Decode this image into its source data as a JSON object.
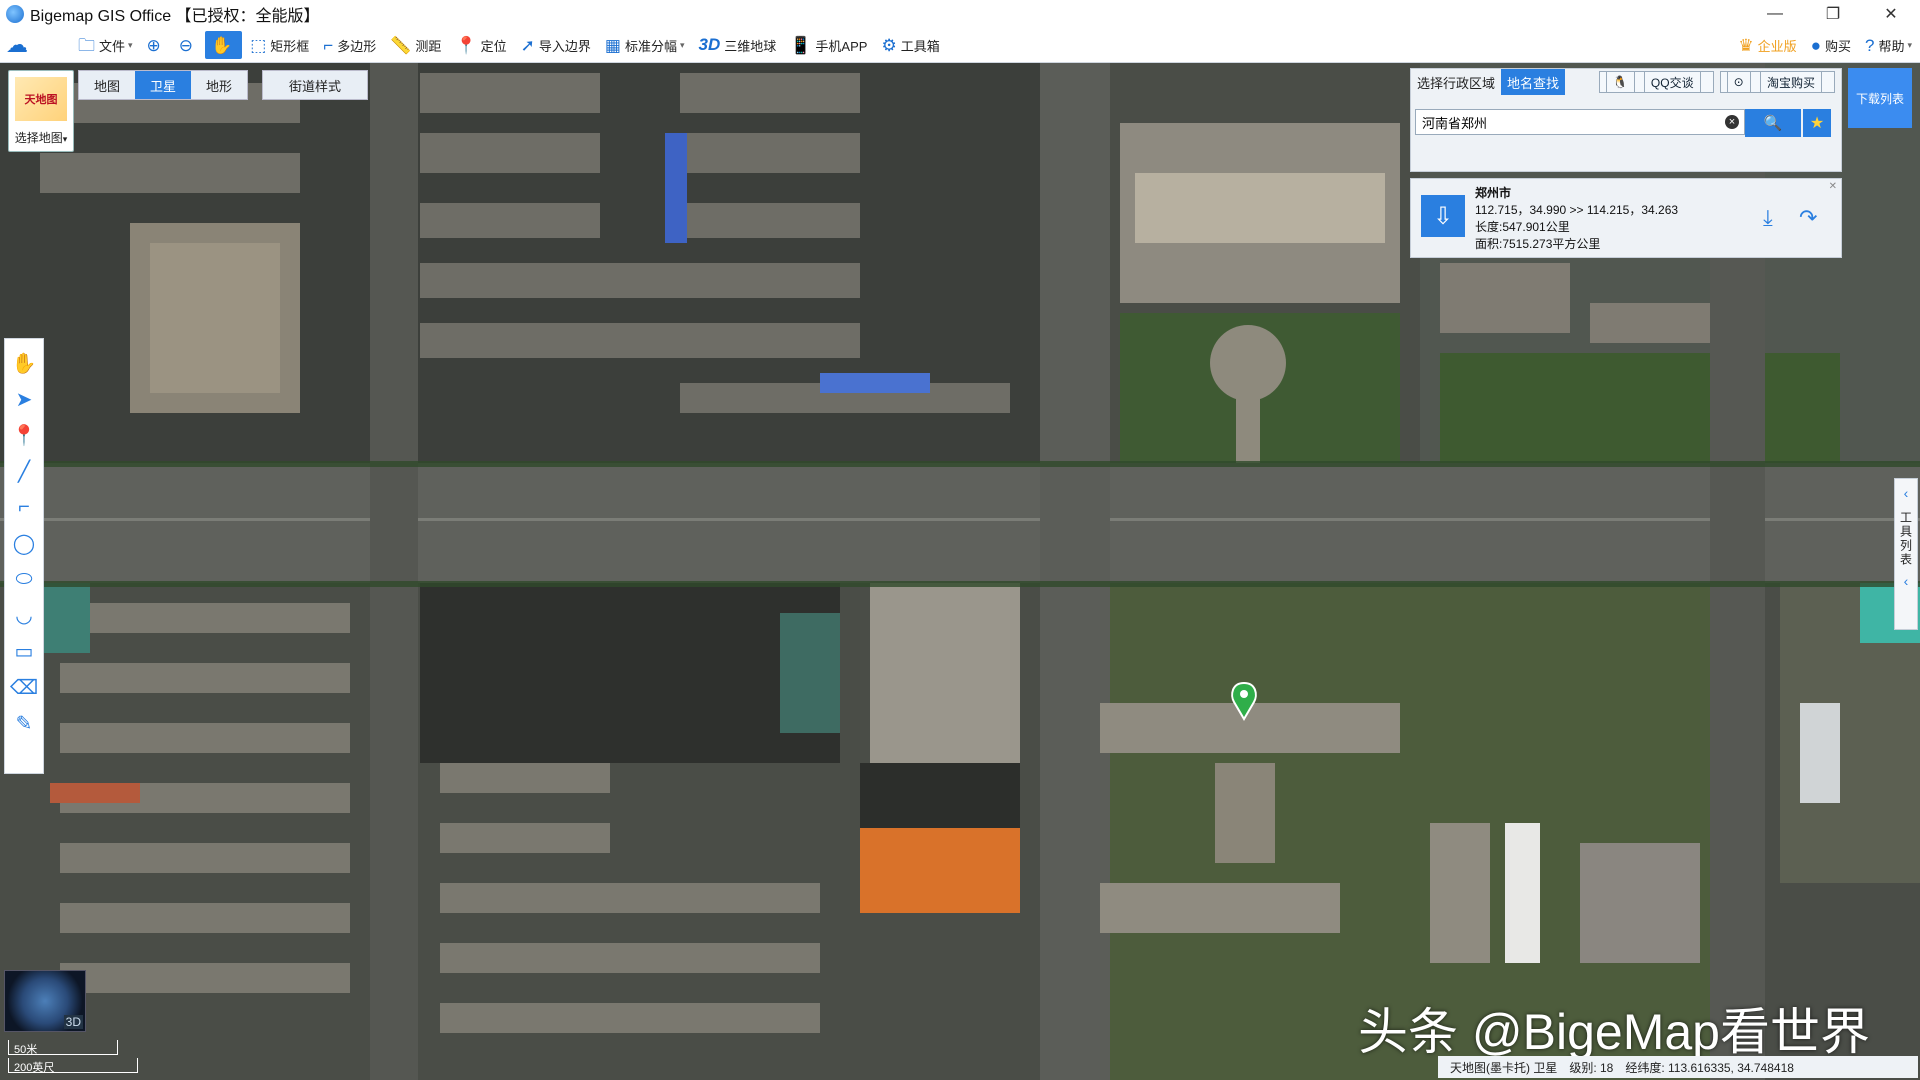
{
  "window": {
    "title": "Bigemap GIS Office 【已授权：全能版】",
    "minimize": "—",
    "maximize": "❐",
    "close": "✕"
  },
  "toolbar": {
    "items": [
      {
        "label": "",
        "icon": "logo-icon"
      },
      {
        "label": "文件",
        "icon": "folder-icon",
        "dropdown": "▾"
      },
      {
        "label": "",
        "icon": "zoom-in-icon"
      },
      {
        "label": "",
        "icon": "zoom-out-icon"
      },
      {
        "label": "",
        "icon": "pan-hand-icon"
      },
      {
        "label": "矩形框",
        "icon": "rectangle-select-icon"
      },
      {
        "label": "多边形",
        "icon": "polygon-select-icon"
      },
      {
        "label": "测距",
        "icon": "ruler-icon"
      },
      {
        "label": "定位",
        "icon": "location-pin-icon"
      },
      {
        "label": "导入边界",
        "icon": "import-boundary-icon"
      },
      {
        "label": "标准分幅",
        "icon": "grid-icon",
        "dropdown": "▾"
      },
      {
        "label": "三维地球",
        "icon": "3d-icon",
        "badge": "3D"
      },
      {
        "label": "手机APP",
        "icon": "phone-icon"
      },
      {
        "label": "工具箱",
        "icon": "gear-icon"
      }
    ],
    "right": [
      {
        "label": "企业版",
        "icon": "crown-icon"
      },
      {
        "label": "购买",
        "icon": "buy-icon"
      },
      {
        "label": "帮助",
        "icon": "help-icon",
        "dropdown": "▾"
      }
    ]
  },
  "map_selector": {
    "label": "选择地图",
    "logo_text": "天地图",
    "tabs": [
      "地图",
      "卫星",
      "地形"
    ],
    "selected_tab": "卫星",
    "street_style": "街道样式"
  },
  "left_tools": [
    "hand-icon",
    "pointer-icon",
    "marker-icon",
    "line-icon",
    "measure-area-icon",
    "circle-icon",
    "lasso-icon",
    "curve-icon",
    "rectangle-icon",
    "eraser-icon",
    "edit-icon"
  ],
  "search": {
    "tabs": [
      "选择行政区域",
      "地名查找"
    ],
    "selected_tab": "地名查找",
    "qq_label": "QQ交谈",
    "taobao_label": "淘宝购买",
    "query": "河南省郑州",
    "clear": "×"
  },
  "result": {
    "name": "郑州市",
    "coords": "112.715，34.990 >> 114.215，34.263",
    "length": "长度:547.901公里",
    "area": "面积:7515.273平方公里"
  },
  "download_list": "下载列表",
  "right_tab": {
    "label": "工具列表"
  },
  "globe_label": "3D",
  "scale": {
    "metric": "50米",
    "imperial": "200英尺"
  },
  "watermark": "头条 @BigeMap看世界",
  "status": {
    "source": "天地图(墨卡托) 卫星",
    "level": "级别: 18",
    "coords": "经纬度: 113.616335, 34.748418"
  },
  "colors": {
    "accent": "#2a7fe0",
    "marker": "#2fae4a"
  }
}
